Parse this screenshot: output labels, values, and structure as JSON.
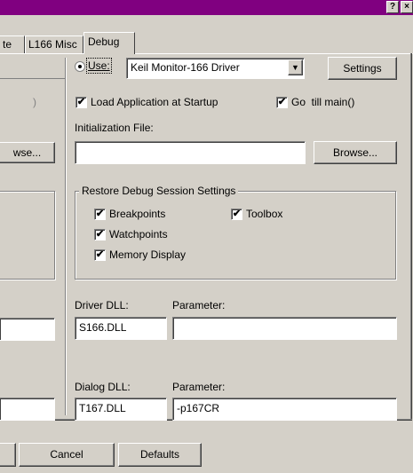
{
  "title_bar": {
    "help": "?",
    "close": "×"
  },
  "tabs": [
    {
      "label": "te"
    },
    {
      "label": "L166 Misc"
    },
    {
      "label": "Debug"
    }
  ],
  "left": {
    "partial_label": ")",
    "browse_partial": "wse...",
    "driver_value_partial": "",
    "dialog_value_partial": "",
    "ok_partial": ""
  },
  "right": {
    "use_label": "Use:",
    "driver_select": "Keil Monitor-166 Driver",
    "settings_button": "Settings",
    "load_app": "Load Application at Startup",
    "go_till_main": "Go  till main()",
    "init_file_label": "Initialization File:",
    "init_file_value": "",
    "browse_button": "Browse...",
    "restore_group": "Restore Debug Session Settings",
    "breakpoints": "Breakpoints",
    "toolbox": "Toolbox",
    "watchpoints": "Watchpoints",
    "memory_display": "Memory Display",
    "driver_dll_label": "Driver DLL:",
    "driver_param_label": "Parameter:",
    "driver_dll_value": "S166.DLL",
    "driver_param_value": "",
    "dialog_dll_label": "Dialog DLL:",
    "dialog_param_label": "Parameter:",
    "dialog_dll_value": "T167.DLL",
    "dialog_param_value": "-p167CR"
  },
  "footer": {
    "cancel": "Cancel",
    "defaults": "Defaults"
  },
  "icons": {
    "check": "✔",
    "dropdown": "▼"
  }
}
